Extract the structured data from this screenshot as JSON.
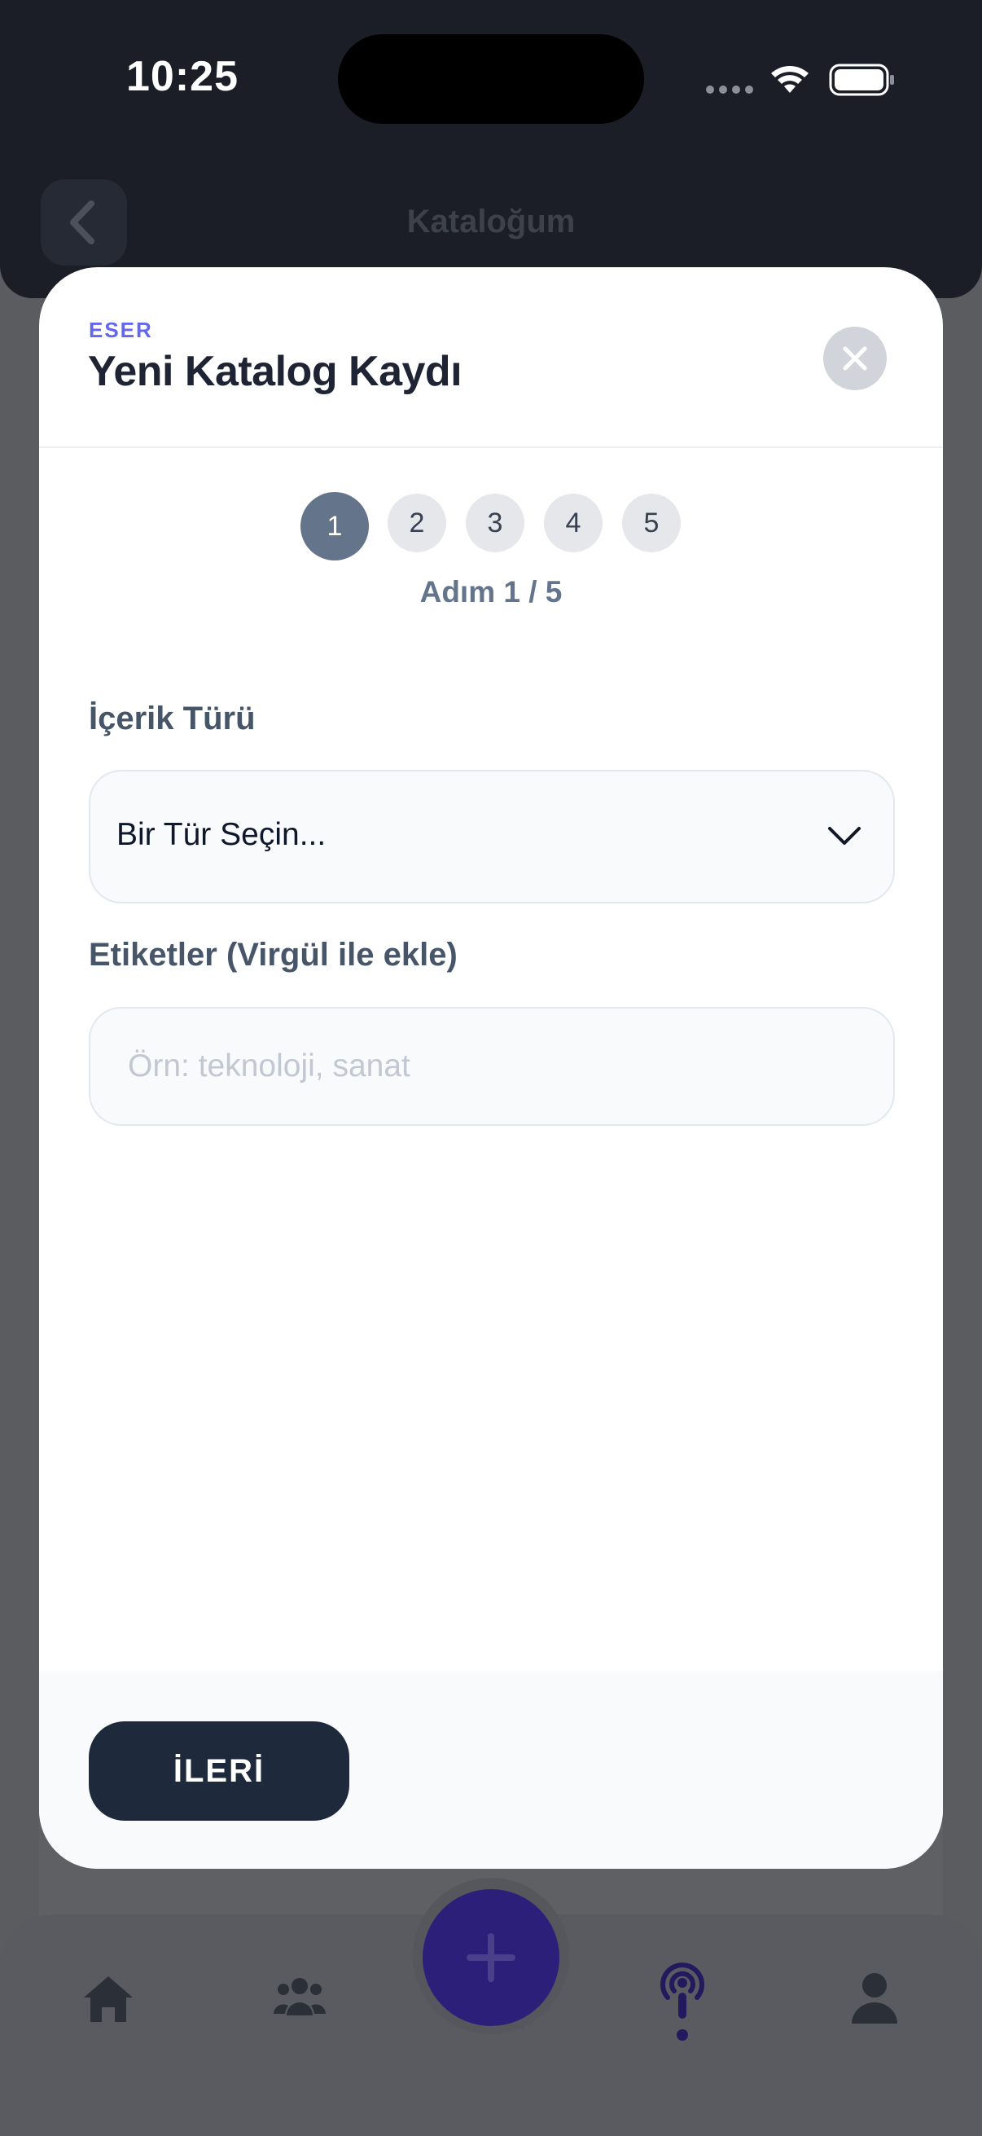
{
  "status_bar": {
    "time": "10:25",
    "icons": [
      "cellular-dots-icon",
      "wifi-icon",
      "battery-icon"
    ]
  },
  "header": {
    "title": "Kataloğum",
    "back_icon": "chevron-left-icon"
  },
  "modal": {
    "eyebrow": "ESER",
    "title": "Yeni Katalog Kaydı",
    "close_icon": "close-icon",
    "steps": [
      "1",
      "2",
      "3",
      "4",
      "5"
    ],
    "active_step": 1,
    "step_caption": "Adım 1 / 5",
    "content_type": {
      "label": "İçerik Türü",
      "value": "Bir Tür Seçin...",
      "icon": "chevron-down-icon"
    },
    "tags": {
      "label": "Etiketler (Virgül ile ekle)",
      "value": "",
      "placeholder": "Örn: teknoloji, sanat"
    },
    "next_label": "İLERİ"
  },
  "tabbar": {
    "items": [
      "home-icon",
      "users-icon",
      "add-icon",
      "podcast-icon",
      "profile-icon"
    ]
  },
  "colors": {
    "accent": "#6366f1",
    "primary_dark": "#1e293b",
    "step_active": "#64748b",
    "fab": "#2c1f7a"
  }
}
